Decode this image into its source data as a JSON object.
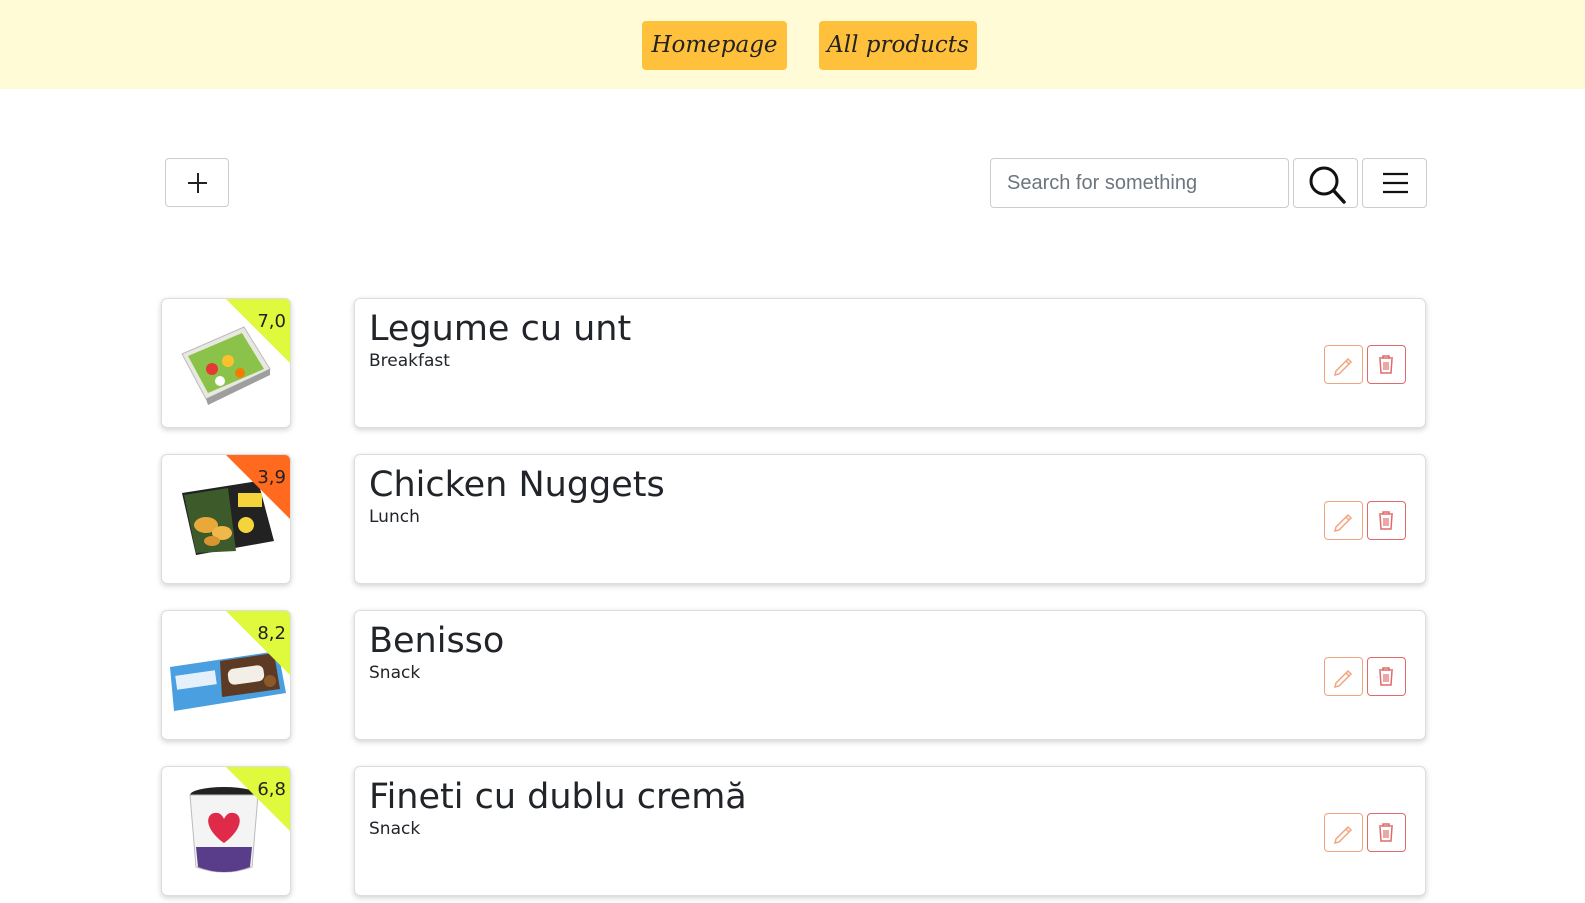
{
  "nav": {
    "homepage_label": "Homepage",
    "all_products_label": "All products"
  },
  "toolbar": {
    "add_icon": "plus-icon",
    "search_placeholder": "Search for something",
    "search_value": "",
    "search_icon": "search-icon",
    "menu_icon": "hamburger-menu-icon"
  },
  "colors": {
    "topbar_bg": "#fffbd6",
    "nav_button": "#ffc13b",
    "score_high": "#dffa3c",
    "score_low": "#ff6a1f",
    "edit_border": "#f2a47e",
    "delete_border": "#e06a6a"
  },
  "products": [
    {
      "title": "Legume cu unt",
      "category": "Breakfast",
      "score": "7,0",
      "score_color": "#dffa3c",
      "image": "frozen-vegetables-box"
    },
    {
      "title": "Chicken Nuggets",
      "category": "Lunch",
      "score": "3,9",
      "score_color": "#ff6a1f",
      "image": "chicken-nuggets-box"
    },
    {
      "title": "Benisso",
      "category": "Snack",
      "score": "8,2",
      "score_color": "#dffa3c",
      "image": "chocolate-bar-wrapper"
    },
    {
      "title": "Fineti cu dublu cremă",
      "category": "Snack",
      "score": "6,8",
      "score_color": "#dffa3c",
      "image": "spread-jar"
    }
  ]
}
